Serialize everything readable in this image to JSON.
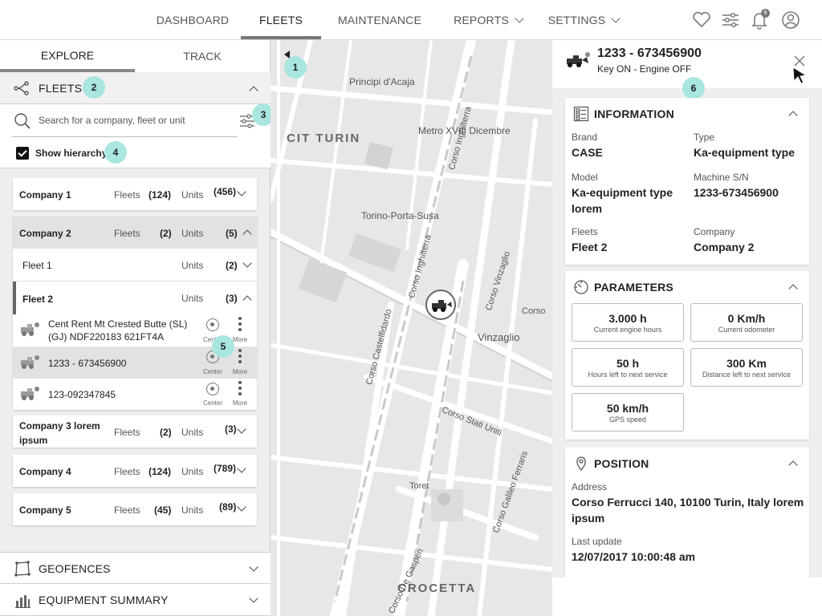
{
  "nav": {
    "items": [
      {
        "label": "DASHBOARD"
      },
      {
        "label": "FLEETS"
      },
      {
        "label": "MAINTENANCE"
      },
      {
        "label": "REPORTS"
      },
      {
        "label": "SETTINGS"
      }
    ],
    "active": "FLEETS",
    "notification_count": "9",
    "icons": [
      "heart-icon",
      "sliders-icon",
      "bell-icon",
      "user-icon"
    ]
  },
  "left_panel": {
    "tabs": [
      {
        "label": "EXPLORE"
      },
      {
        "label": "TRACK"
      }
    ],
    "fleets_title": "FLEETS",
    "search_placeholder": "Search for a company, fleet or unit",
    "show_hierarchy_label": "Show hierarchy",
    "fleets_label": "Fleets",
    "units_label": "Units",
    "companies": [
      {
        "name": "Company 1",
        "fleets": "(124)",
        "units": "(456)"
      },
      {
        "name": "Company 2",
        "fleets": "(2)",
        "units": "(5)"
      },
      {
        "name": "Company 3 lorem ipsum",
        "fleets": "(2)",
        "units": "(3)"
      },
      {
        "name": "Company 4",
        "fleets": "(124)",
        "units": "(789)"
      },
      {
        "name": "Company 5",
        "fleets": "(45)",
        "units": "(89)"
      }
    ],
    "fleets": [
      {
        "name": "Fleet 1",
        "units": "(2)"
      },
      {
        "name": "Fleet 2",
        "units": "(3)"
      }
    ],
    "units": [
      {
        "name": "Cent Rent Mt Crested Butte (SL) (GJ) NDF220183 621FT4A"
      },
      {
        "name": "1233 - 673456900"
      },
      {
        "name": "123-092347845"
      }
    ],
    "center_label": "Center",
    "more_label": "More",
    "geofences_label": "GEOFENCES",
    "equipment_summary_label": "EQUIPMENT SUMMARY"
  },
  "callouts": [
    "1",
    "2",
    "3",
    "4",
    "5",
    "6"
  ],
  "map": {
    "labels": {
      "principi": "Principi d'Acaja",
      "metro": "Metro XVIII Dicembre",
      "cit_turin": "CIT TURIN",
      "corso_inghilterra_1": "Corso Inghilterra",
      "torino_porta_susa": "Torino-Porta-Susa",
      "corso_inghilterra_2": "Corso Inghilterra",
      "corso_vinzaglio": "Corso Vinzaglio",
      "corso_castelfidardo": "Corso Castelfidardo",
      "vinzaglio": "Vinzaglio",
      "corso_cut": "Corso",
      "corso_stati_uniti": "Corso Stati Uniti",
      "toret": "Toret",
      "corso_galileo_ferraris": "Corso Galileo Ferraris",
      "de_gasperi": "Corso De Gasperi",
      "crocetta": "CROCETTA"
    }
  },
  "detail": {
    "title": "1233 - 673456900",
    "subtitle": "Key ON - Engine OFF",
    "information": {
      "title": "INFORMATION",
      "fields": [
        {
          "label": "Brand",
          "value": "CASE"
        },
        {
          "label": "Type",
          "value": "Ka-equipment type"
        },
        {
          "label": "Model",
          "value": "Ka-equipment type lorem"
        },
        {
          "label": "Machine S/N",
          "value": "1233-673456900"
        },
        {
          "label": "Fleets",
          "value": "Fleet 2"
        },
        {
          "label": "Company",
          "value": "Company 2"
        }
      ]
    },
    "parameters": {
      "title": "PARAMETERS",
      "items": [
        {
          "value": "3.000 h",
          "label": "Current engine hours"
        },
        {
          "value": "0 Km/h",
          "label": "Current odometer"
        },
        {
          "value": "50 h",
          "label": "Hours left to next service"
        },
        {
          "value": "300 Km",
          "label": "Distance left to next service"
        },
        {
          "value": "50 km/h",
          "label": "GPS speed"
        }
      ]
    },
    "position": {
      "title": "POSITION",
      "address_label": "Address",
      "address": "Corso Ferrucci 140, 10100 Turin, Italy lorem ipsum",
      "last_update_label": "Last update",
      "last_update": "12/07/2017 10:00:48 am"
    }
  }
}
